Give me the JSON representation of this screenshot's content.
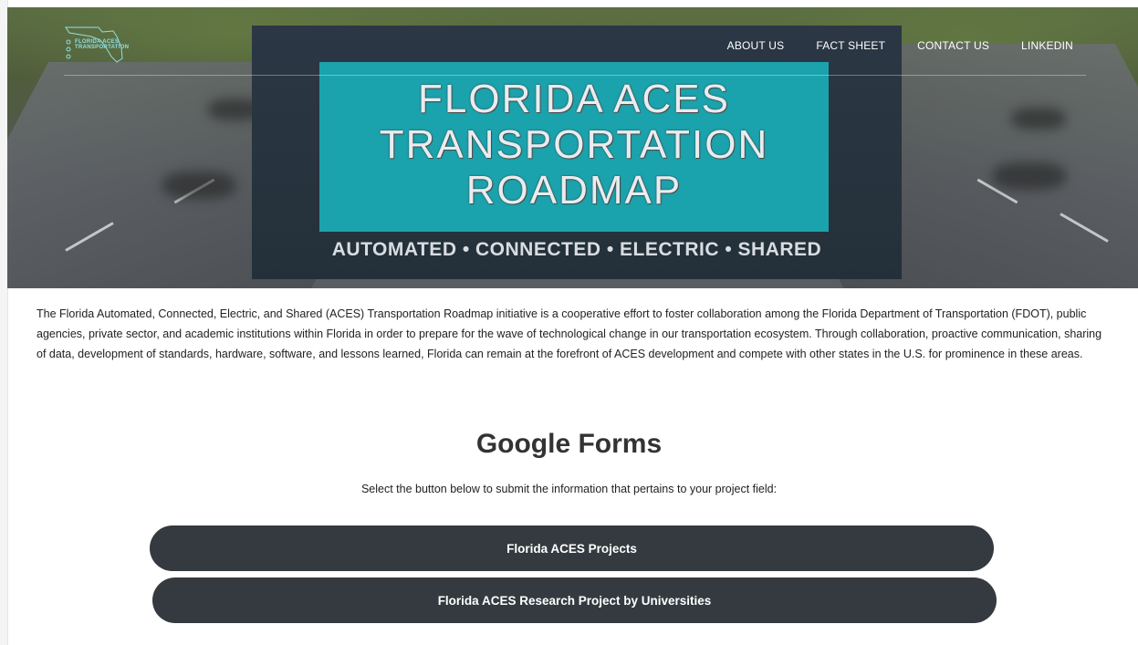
{
  "nav": {
    "logo_text": "FLORIDA ACES TRANSPORTATION",
    "links": [
      "ABOUT US",
      "FACT SHEET",
      "CONTACT US",
      "LINKEDIN"
    ]
  },
  "hero": {
    "title_lines": [
      "FLORIDA ACES",
      "TRANSPORTATION",
      "ROADMAP"
    ],
    "tagline": "AUTOMATED • CONNECTED • ELECTRIC • SHARED"
  },
  "intro": "The Florida Automated, Connected, Electric, and Shared (ACES) Transportation Roadmap initiative is a cooperative effort to foster collaboration among the Florida Department of Transportation (FDOT), public agencies, private sector, and academic institutions within Florida in order to prepare for the wave of technological change in our transportation ecosystem. Through collaboration, proactive communication, sharing of data, development of standards, hardware, software, and lessons learned, Florida can remain at the forefront of ACES development and compete with other states in the U.S. for prominence in these areas.",
  "forms": {
    "title": "Google Forms",
    "subtitle": "Select the button below to submit the information that pertains to your project field:",
    "buttons": [
      "Florida ACES Projects",
      "Florida ACES Research Project by Universities"
    ]
  },
  "colors": {
    "button_bg": "#343a3f",
    "banner_teal": "#1ba3ad",
    "banner_dark": "#2b3744"
  }
}
